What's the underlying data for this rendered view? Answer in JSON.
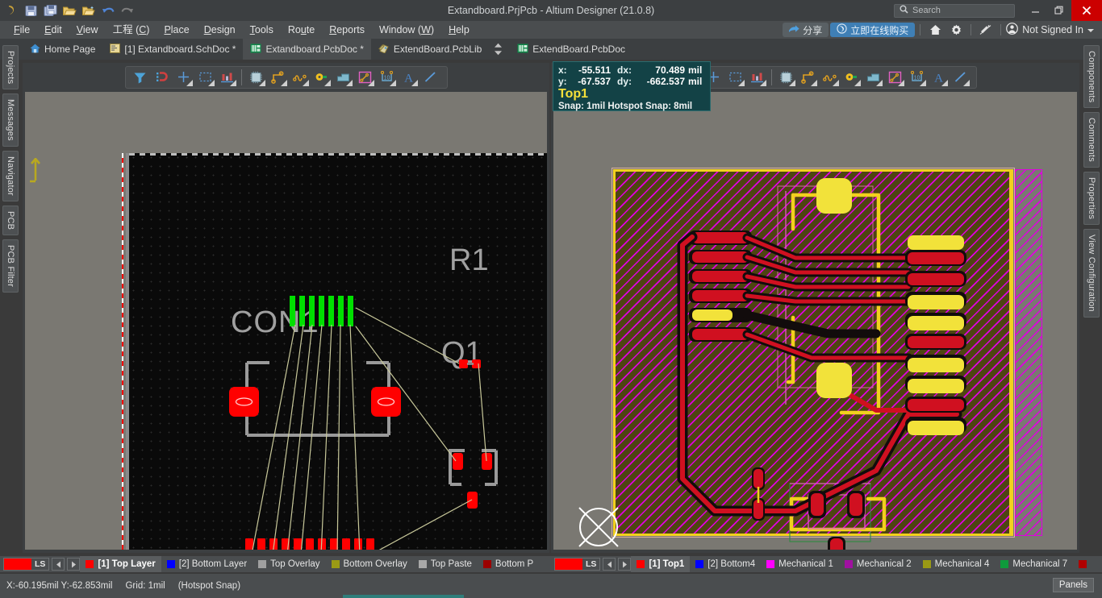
{
  "window": {
    "title": "Extandboard.PrjPcb - Altium Designer (21.0.8)",
    "minimize": "–",
    "maximize": "❐",
    "close": "✕"
  },
  "search": {
    "placeholder": "Search",
    "icon": "search-icon"
  },
  "quick_access": [
    {
      "name": "altium-logo-icon"
    },
    {
      "name": "save-icon"
    },
    {
      "name": "save-all-icon"
    },
    {
      "name": "open-icon"
    },
    {
      "name": "open-project-icon"
    },
    {
      "name": "undo-icon"
    },
    {
      "name": "redo-icon"
    }
  ],
  "menu": [
    {
      "label": "File",
      "accel": "F"
    },
    {
      "label": "Edit",
      "accel": "E"
    },
    {
      "label": "View",
      "accel": "V"
    },
    {
      "label": "工程 (C)",
      "accel": "C"
    },
    {
      "label": "Place",
      "accel": "P"
    },
    {
      "label": "Design",
      "accel": "D"
    },
    {
      "label": "Tools",
      "accel": "T"
    },
    {
      "label": "Route",
      "accel": "u"
    },
    {
      "label": "Reports",
      "accel": "R"
    },
    {
      "label": "Window (W)",
      "accel": "W"
    },
    {
      "label": "Help",
      "accel": "H"
    }
  ],
  "menu_right": {
    "share_label": "分享",
    "buy_label": "立即在线购买",
    "home_icon": "home-icon",
    "settings_icon": "gear-icon",
    "extensions_icon": "extensions-icon",
    "account_icon": "account-icon",
    "account_label": "Not Signed In"
  },
  "doc_tabs": [
    {
      "label": "Home Page",
      "icon": "home-icon",
      "active": false
    },
    {
      "label": "[1] Extandboard.SchDoc *",
      "icon": "schematic-icon",
      "active": false
    },
    {
      "label": "Extandboard.PcbDoc *",
      "icon": "pcb-icon",
      "active": true
    },
    {
      "label": "ExtendBoard.PcbLib",
      "icon": "pcblib-icon",
      "active": false
    }
  ],
  "right_pane_tab": {
    "label": "ExtendBoard.PcbDoc",
    "icon": "pcb-icon"
  },
  "left_panel_tabs": [
    "Projects",
    "Messages",
    "Navigator",
    "PCB",
    "PCB Filter"
  ],
  "right_panel_tabs": [
    "Components",
    "Comments",
    "Properties",
    "View Configuration"
  ],
  "pcb_toolbar_icons": [
    "filter-icon",
    "net-highlight-icon",
    "place-via-icon",
    "select-area-icon",
    "measure-icon",
    "divider",
    "place-component-icon",
    "interactive-routing-icon",
    "differential-pair-icon",
    "place-pad-icon",
    "place-polygon-icon",
    "place-keepout-icon",
    "place-dimension-icon",
    "place-string-icon",
    "place-line-icon"
  ],
  "hud": {
    "x_key": "x:",
    "x_val": "-55.511",
    "dx_key": "dx:",
    "dx_val": "70.489",
    "unit1": "mil",
    "y_key": "y:",
    "y_val": "-67.537",
    "dy_key": "dy:",
    "dy_val": "-662.537",
    "unit2": "mil",
    "layer": "Top1",
    "snap": "Snap: 1mil Hotspot Snap: 8mil"
  },
  "canvas_left": {
    "designators": [
      "CON1",
      "R1",
      "Q1"
    ],
    "background": "#0a0a0a",
    "board_outline_color": "#ff0000",
    "pad_color": "#ff0000",
    "top_pad_color": "#00e000",
    "ratsnest_color": "#c8c89a",
    "silkscreen_color": "#9a9a9a"
  },
  "canvas_right": {
    "copper_fill": "#4e4412",
    "hatch_color": "#e000e0",
    "board_edge": "#f2d01e",
    "track_color": "#d01020",
    "pad_color": "#d01020",
    "via_color": "#f2e23a",
    "keepout_color": "#e000e0",
    "cursor": "crosshair-circle"
  },
  "layer_bar_left": {
    "ls_label": "LS",
    "ls_color": "#ff0000",
    "prev_arrow": "◀",
    "next_arrow": "▶",
    "layers": [
      {
        "label": "[1] Top Layer",
        "color": "#ff0000",
        "active": true
      },
      {
        "label": "[2] Bottom Layer",
        "color": "#0000ff",
        "active": false
      },
      {
        "label": "Top Overlay",
        "color": "#a0a0a0",
        "active": false
      },
      {
        "label": "Bottom Overlay",
        "color": "#9a9a15",
        "active": false
      },
      {
        "label": "Top Paste",
        "color": "#a8a8a8",
        "active": false
      },
      {
        "label": "Bottom P",
        "color": "#9b0000",
        "active": false
      }
    ]
  },
  "layer_bar_right": {
    "ls_label": "LS",
    "ls_color": "#ff0000",
    "prev_arrow": "◀",
    "next_arrow": "▶",
    "layers": [
      {
        "label": "[1] Top1",
        "color": "#ff0000",
        "active": true
      },
      {
        "label": "[2] Bottom4",
        "color": "#0000ff",
        "active": false
      },
      {
        "label": "Mechanical 1",
        "color": "#ff00ff",
        "active": false
      },
      {
        "label": "Mechanical 2",
        "color": "#a010a0",
        "active": false
      },
      {
        "label": "Mechanical 4",
        "color": "#9a9a15",
        "active": false
      },
      {
        "label": "Mechanical 7",
        "color": "#0f9a3c",
        "active": false
      },
      {
        "label": "",
        "color": "#b00000",
        "active": false
      }
    ]
  },
  "status_bar": {
    "coords": "X:-60.195mil Y:-62.853mil",
    "grid": "Grid: 1mil",
    "snap": "(Hotspot Snap)",
    "panels_label": "Panels"
  }
}
